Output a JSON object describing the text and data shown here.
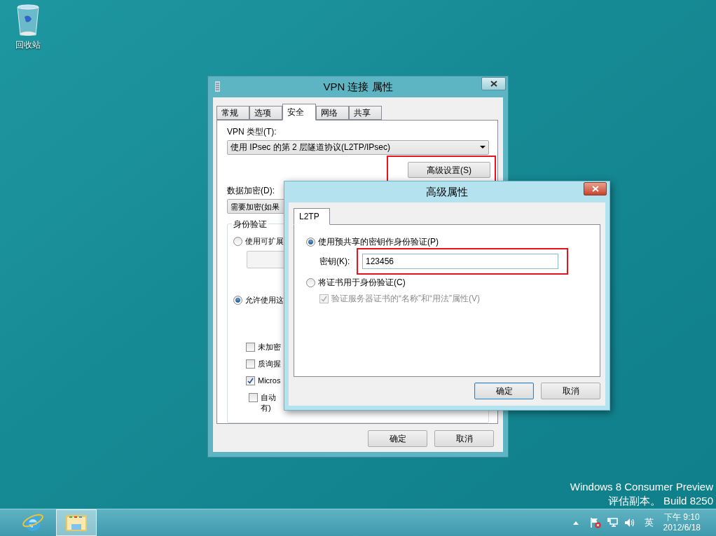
{
  "desktop": {
    "icons": [
      {
        "label": "回收站"
      }
    ],
    "edition": [
      "Windows 8 Consumer Preview",
      "评估副本。 Build 8250"
    ]
  },
  "vpn_dialog": {
    "title": "VPN 连接 属性",
    "tabs": [
      {
        "label": "常规",
        "selected": false
      },
      {
        "label": "选项",
        "selected": false
      },
      {
        "label": "安全",
        "selected": true
      },
      {
        "label": "网络",
        "selected": false
      },
      {
        "label": "共享",
        "selected": false
      }
    ],
    "vpn_type_label": "VPN 类型(T):",
    "vpn_type_value": "使用 IPsec 的第 2 层隧道协议(L2TP/IPsec)",
    "advanced_button": {
      "label": "高级设置(S)",
      "highlighted": true
    },
    "encryption_label": "数据加密(D):",
    "encryption_value": "需要加密(如果",
    "auth_group": {
      "title": "身份验证",
      "items": [
        {
          "kind": "radio",
          "label": "使用可扩展",
          "selected": false
        },
        {
          "kind": "radio",
          "label": "允许使用这",
          "selected": true
        },
        {
          "kind": "checkbox",
          "label": "未加密",
          "checked": false
        },
        {
          "kind": "checkbox",
          "label": "质询握",
          "checked": false
        },
        {
          "kind": "checkbox",
          "label": "Micros",
          "checked": true,
          "children": [
            {
              "kind": "checkbox",
              "label": "自动",
              "continuation": "有)",
              "checked": false
            }
          ]
        }
      ]
    },
    "buttons": [
      {
        "label": "确定"
      },
      {
        "label": "取消"
      }
    ]
  },
  "advanced_dialog": {
    "title": "高级属性",
    "tabs": [
      {
        "label": "L2TP",
        "selected": true
      }
    ],
    "options": [
      {
        "kind": "radio",
        "label": "使用预共享的密钥作身份验证(P)",
        "selected": true
      },
      {
        "kind": "key",
        "label": "密钥(K):",
        "value": "123456",
        "highlighted": true
      },
      {
        "kind": "radio",
        "label": "将证书用于身份验证(C)",
        "selected": false
      },
      {
        "kind": "checkbox",
        "label": "验证服务器证书的“名称”和“用法”属性(V)",
        "checked": true,
        "disabled": true
      }
    ],
    "buttons": [
      {
        "label": "确定",
        "default": true
      },
      {
        "label": "取消",
        "default": false
      }
    ]
  },
  "taskbar": {
    "apps": [
      {
        "kind": "browser",
        "active": false
      },
      {
        "kind": "explorer",
        "active": true
      }
    ],
    "ime": "英",
    "time": "下午 9:10",
    "date": "2012/6/18"
  }
}
